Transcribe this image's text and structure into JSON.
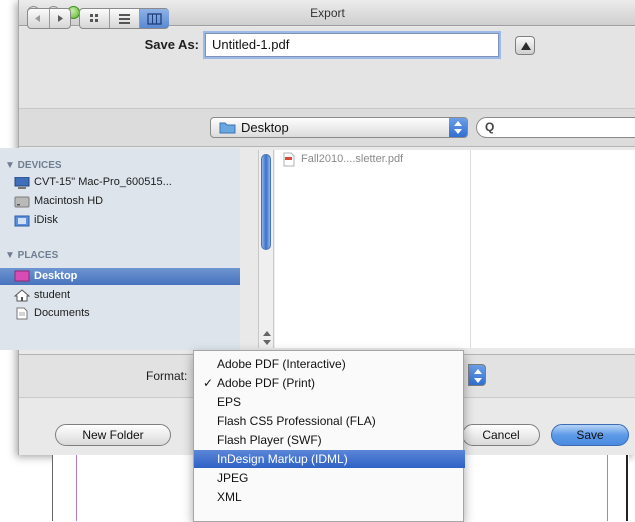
{
  "window": {
    "title": "Export"
  },
  "save_as": {
    "label": "Save As:",
    "value": "Untitled-1.pdf"
  },
  "toolbar": {
    "location": "Desktop",
    "search_glyph": "Q"
  },
  "sidebar": {
    "devices_header": "▼ DEVICES",
    "places_header": "▼ PLACES",
    "devices": [
      "CVT-15\" Mac-Pro_600515...",
      "Macintosh HD",
      "iDisk"
    ],
    "places": [
      "Desktop",
      "student",
      "Documents"
    ]
  },
  "files": [
    "Fall2010....sletter.pdf"
  ],
  "format": {
    "label": "Format:"
  },
  "buttons": {
    "new_folder": "New Folder",
    "cancel": "Cancel",
    "save": "Save"
  },
  "menu": {
    "items": [
      "Adobe PDF (Interactive)",
      "Adobe PDF (Print)",
      "EPS",
      "Flash CS5 Professional (FLA)",
      "Flash Player (SWF)",
      "InDesign Markup (IDML)",
      "JPEG",
      "XML"
    ],
    "checkmark": "✓"
  },
  "colors": {
    "accent": "#3a6fcf",
    "sidebar_bg": "#dde4ec"
  }
}
